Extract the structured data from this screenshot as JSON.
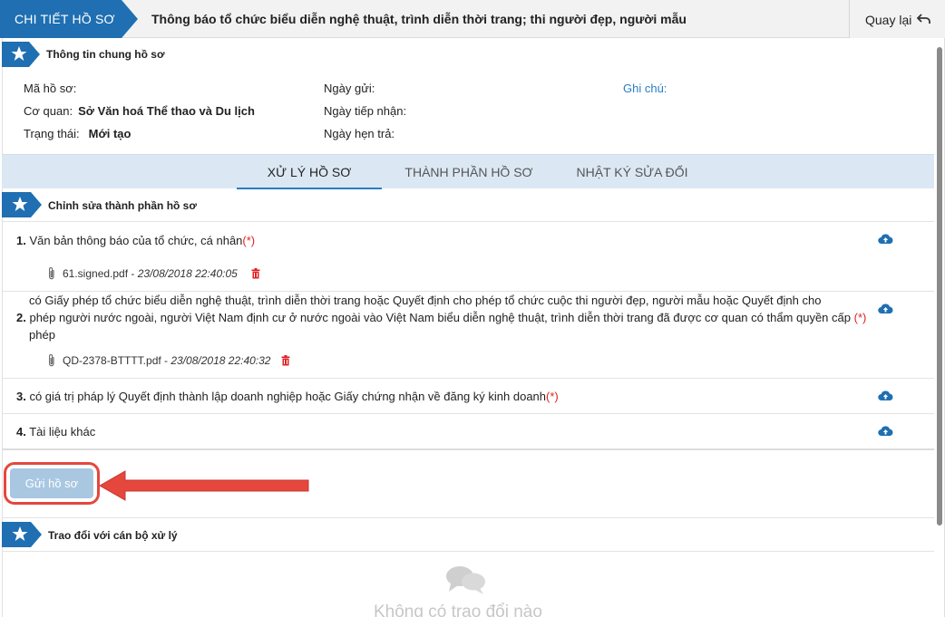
{
  "header": {
    "breadcrumb": "CHI TIẾT HỒ SƠ",
    "title": "Thông báo tổ chức biểu diễn nghệ thuật, trình diễn thời trang; thi người đẹp, người mẫu",
    "back_label": "Quay lại",
    "back_icon": "undo-arrow-icon"
  },
  "general_info": {
    "section_title": "Thông tin chung hồ sơ",
    "ma_ho_so_label": "Mã hồ sơ:",
    "co_quan_label": "Cơ quan:",
    "co_quan_value": "Sở Văn hoá Thể thao và Du lịch",
    "trang_thai_label": "Trạng thái:",
    "trang_thai_value": "Mới tạo",
    "ngay_gui_label": "Ngày gửi:",
    "ngay_tiep_nhan_label": "Ngày tiếp nhận:",
    "ngay_hen_tra_label": "Ngày hẹn trả:",
    "ghi_chu_label": "Ghi chú:"
  },
  "tabs": [
    {
      "label": "XỬ LÝ HỒ SƠ",
      "active": true
    },
    {
      "label": "THÀNH PHẦN HỒ SƠ",
      "active": false
    },
    {
      "label": "NHẬT KÝ SỬA ĐỔI",
      "active": false
    }
  ],
  "components": {
    "section_title": "Chỉnh sửa thành phần hồ sơ",
    "required_mark": "(*)",
    "items": [
      {
        "number": "1.",
        "title": "Văn bản thông báo của tổ chức, cá nhân",
        "required": true,
        "file_name": "61.signed.pdf",
        "file_sep": " - ",
        "file_date": "23/08/2018 22:40:05"
      },
      {
        "number": "2.",
        "title_line1": "có Giấy phép tổ chức biểu diễn nghệ thuật, trình diễn thời trang hoặc Quyết định cho phép tổ chức cuộc thi người đẹp, người mẫu hoặc Quyết định cho",
        "title_line2": "phép người nước ngoài, người Việt Nam định cư ở nước ngoài vào Việt Nam biểu diễn nghệ thuật, trình diễn thời trang đã được cơ quan có thẩm quyền cấp",
        "title_line3": "phép",
        "required": true,
        "file_name": "QD-2378-BTTTT.pdf",
        "file_sep": " - ",
        "file_date": "23/08/2018 22:40:32"
      },
      {
        "number": "3.",
        "title": "có giá trị pháp lý Quyết định thành lập doanh nghiệp hoặc Giấy chứng nhận về đăng ký kinh doanh",
        "required": true
      },
      {
        "number": "4.",
        "title": "Tài liệu khác",
        "required": false
      }
    ]
  },
  "actions": {
    "send_label": "Gửi hồ sơ"
  },
  "discussion": {
    "section_title": "Trao đổi với cán bộ xử lý",
    "empty_text": "Không có trao đổi nào"
  },
  "colors": {
    "primary": "#1f6fb2",
    "highlight": "#e5473d",
    "required": "#e02222",
    "link": "#2a7dc4"
  }
}
